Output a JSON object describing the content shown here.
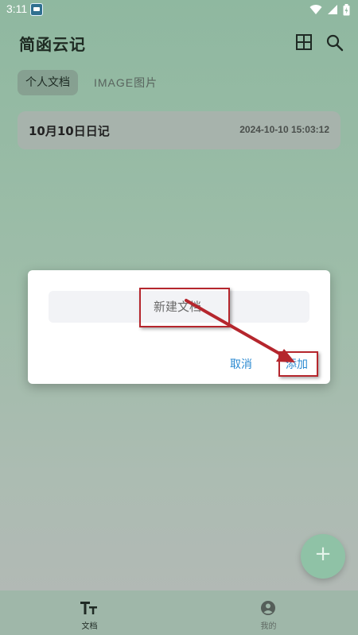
{
  "status_bar": {
    "time": "3:11",
    "icons": [
      "app-icon",
      "wifi-icon",
      "signal-icon",
      "battery-icon"
    ]
  },
  "app": {
    "title": "简函云记"
  },
  "tabs": [
    {
      "label": "个人文档",
      "active": true
    },
    {
      "label": "IMAGE图片",
      "active": false
    }
  ],
  "documents": [
    {
      "title": "10月10日日记",
      "timestamp": "2024-10-10 15:03:12"
    }
  ],
  "dialog": {
    "input_placeholder": "新建文档",
    "input_value": "",
    "cancel_label": "取消",
    "add_label": "添加"
  },
  "fab": {
    "label": "+"
  },
  "bottom_nav": [
    {
      "label": "文档",
      "icon": "text-format-icon",
      "active": true
    },
    {
      "label": "我的",
      "icon": "profile-icon",
      "active": false
    }
  ],
  "colors": {
    "accent": "#2b8ad1",
    "annotation": "#b5262d",
    "fab": "#8fc2a6"
  }
}
